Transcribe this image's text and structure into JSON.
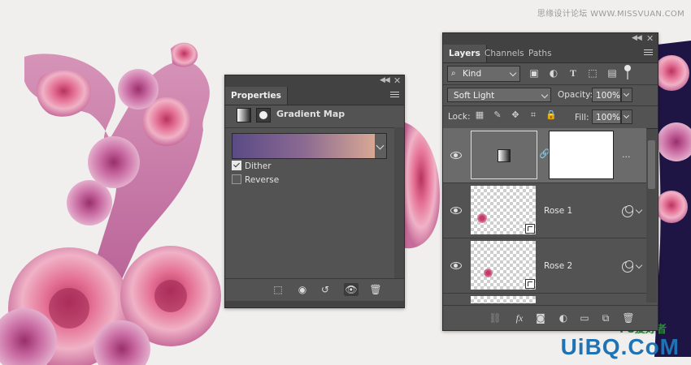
{
  "watermark": {
    "site_text": "思缘设计论坛 WWW.MISSVUAN.COM",
    "logo_text": "UiBQ.CoM",
    "logo_ps": "PS爱好者"
  },
  "properties": {
    "tab_label": "Properties",
    "adjustment_title": "Gradient Map",
    "gradient_colors": [
      "#5a4a85",
      "#8b6a92",
      "#d8a894"
    ],
    "options": [
      {
        "label": "Dither",
        "checked": true
      },
      {
        "label": "Reverse",
        "checked": false
      }
    ],
    "footer_icons": [
      "clip-to-layer-icon",
      "view-previous-state-icon",
      "reset-icon",
      "visibility-icon",
      "trash-icon"
    ]
  },
  "layers": {
    "tabs": [
      {
        "label": "Layers",
        "active": true
      },
      {
        "label": "Channels",
        "active": false
      },
      {
        "label": "Paths",
        "active": false
      }
    ],
    "filter": {
      "label": "Kind"
    },
    "blend_mode": "Soft Light",
    "opacity": {
      "label": "Opacity:",
      "value": "100%"
    },
    "lock": {
      "label": "Lock:"
    },
    "fill": {
      "label": "Fill:",
      "value": "100%"
    },
    "rows": [
      {
        "name": "",
        "type": "adjustment",
        "selected": true,
        "more": "..."
      },
      {
        "name": "Rose 1",
        "type": "smart-object",
        "selected": false
      },
      {
        "name": "Rose 2",
        "type": "smart-object",
        "selected": false
      }
    ],
    "footer_icons": [
      "link-icon",
      "fx-icon",
      "add-mask-icon",
      "new-adjustment-icon",
      "new-group-icon",
      "new-layer-icon",
      "trash-icon"
    ]
  }
}
